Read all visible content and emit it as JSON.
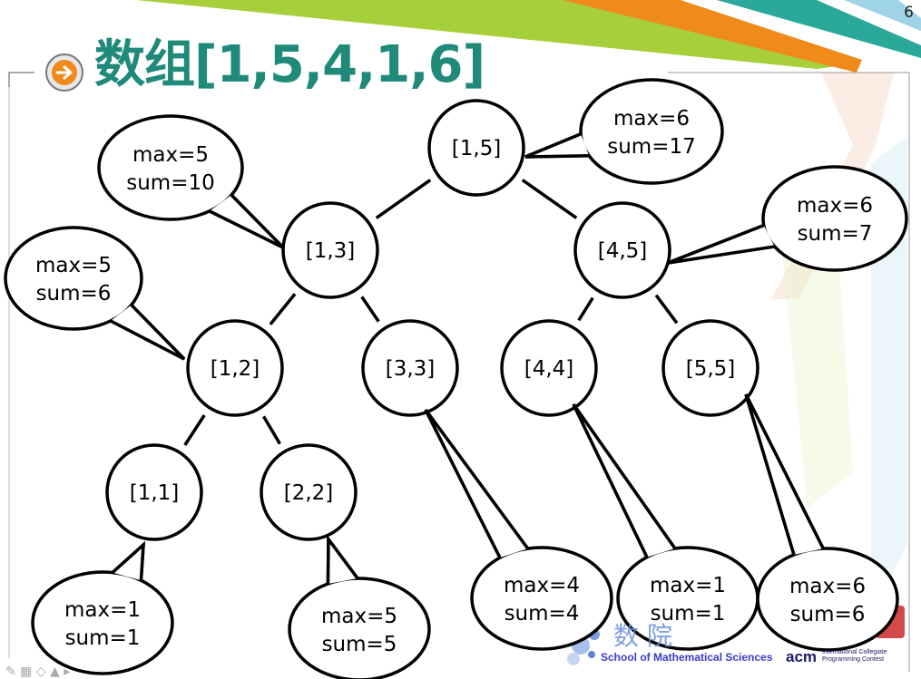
{
  "slide": {
    "title": "数组[1,5,4,1,6]",
    "page_number": "6"
  },
  "tree": {
    "nodes": [
      {
        "id": "n15",
        "label": "[1,5]"
      },
      {
        "id": "n13",
        "label": "[1,3]"
      },
      {
        "id": "n45",
        "label": "[4,5]"
      },
      {
        "id": "n12",
        "label": "[1,2]"
      },
      {
        "id": "n33",
        "label": "[3,3]"
      },
      {
        "id": "n44",
        "label": "[4,4]"
      },
      {
        "id": "n55",
        "label": "[5,5]"
      },
      {
        "id": "n11",
        "label": "[1,1]"
      },
      {
        "id": "n22",
        "label": "[2,2]"
      }
    ],
    "edges": [
      [
        "n15",
        "n13"
      ],
      [
        "n15",
        "n45"
      ],
      [
        "n13",
        "n12"
      ],
      [
        "n13",
        "n33"
      ],
      [
        "n45",
        "n44"
      ],
      [
        "n45",
        "n55"
      ],
      [
        "n12",
        "n11"
      ],
      [
        "n12",
        "n22"
      ]
    ],
    "callouts": [
      {
        "node": "n15",
        "lines": [
          "max=6",
          "sum=17"
        ]
      },
      {
        "node": "n13",
        "lines": [
          "max=5",
          "sum=10"
        ]
      },
      {
        "node": "n45",
        "lines": [
          "max=6",
          "sum=7"
        ]
      },
      {
        "node": "n12",
        "lines": [
          "max=5",
          "sum=6"
        ]
      },
      {
        "node": "n11",
        "lines": [
          "max=1",
          "sum=1"
        ]
      },
      {
        "node": "n22",
        "lines": [
          "max=5",
          "sum=5"
        ]
      },
      {
        "node": "n33",
        "lines": [
          "max=4",
          "sum=4"
        ]
      },
      {
        "node": "n44",
        "lines": [
          "max=1",
          "sum=1"
        ]
      },
      {
        "node": "n55",
        "lines": [
          "max=6",
          "sum=6"
        ]
      }
    ]
  },
  "footer": {
    "school_cn": "数  院",
    "school_en": "School of Mathematical Sciences",
    "acm": "acm",
    "acm_sub": [
      "International Collegiate",
      "Programming Contest"
    ]
  },
  "colors": {
    "title": "#1f8a7a",
    "stroke": "#000000",
    "stripe_green": "#a6cf3a",
    "stripe_orange": "#f08a1a",
    "stripe_teal": "#2aa89a"
  },
  "icons": {
    "title_bullet": "arrow-right-circle-icon"
  }
}
